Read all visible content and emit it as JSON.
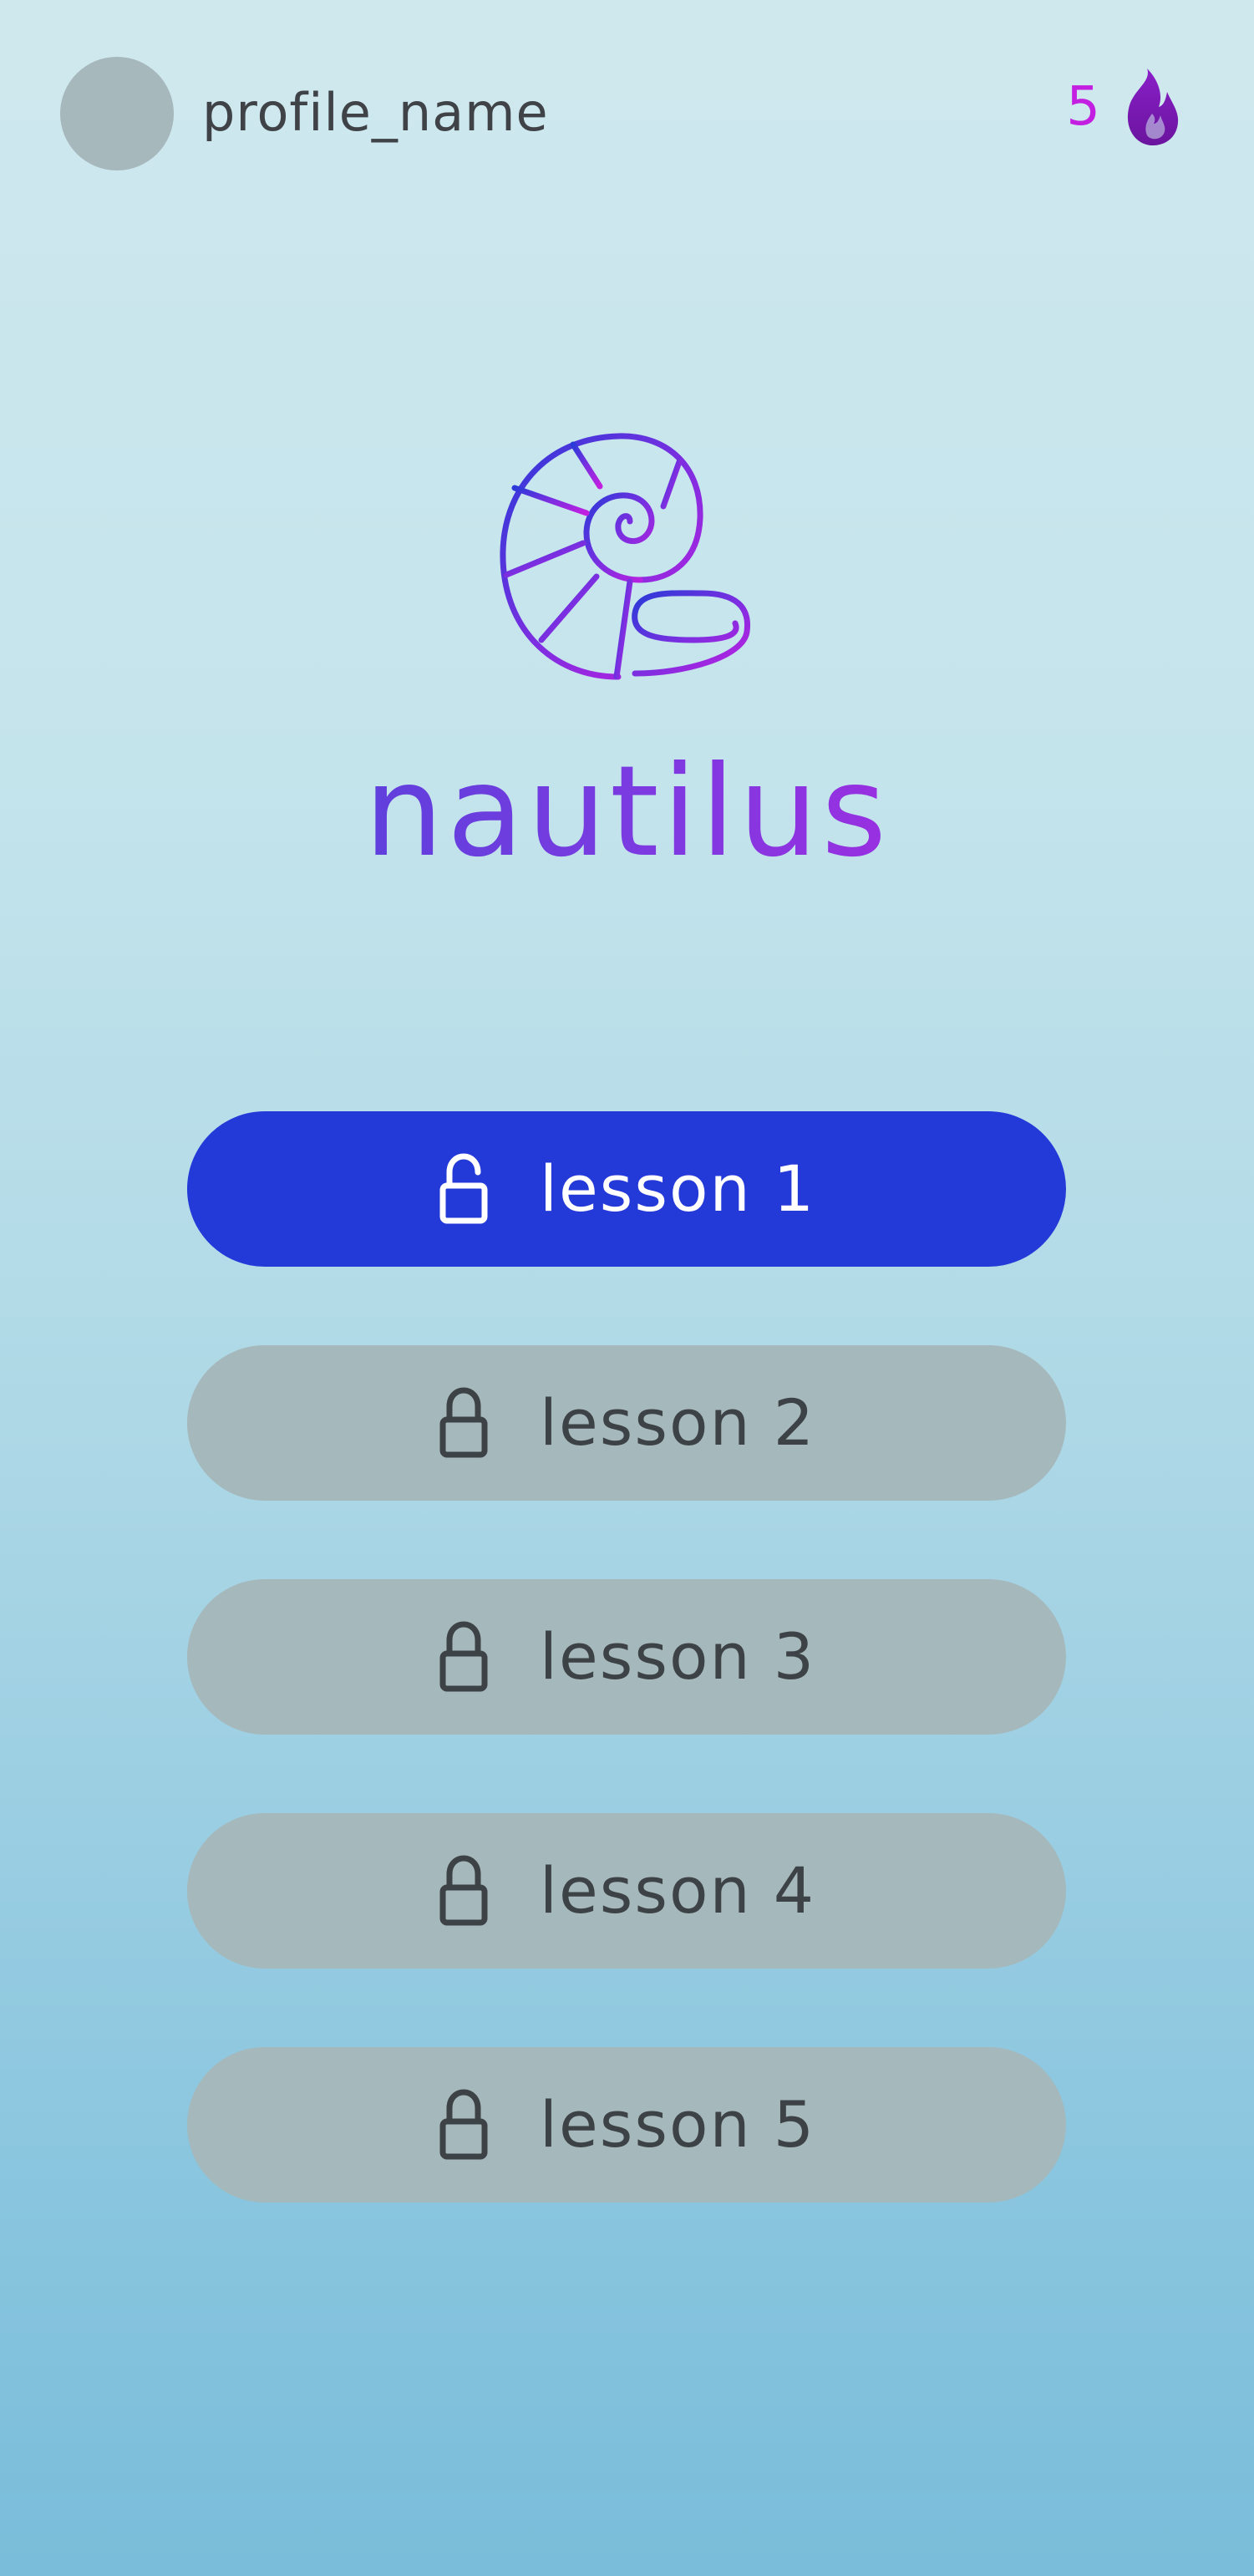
{
  "header": {
    "profile_name": "profile_name",
    "streak_count": "5",
    "streak_icon": "flame-icon"
  },
  "brand": {
    "name": "nautilus",
    "logo_icon": "nautilus-shell-icon"
  },
  "lessons": [
    {
      "label": "lesson 1",
      "state": "unlocked",
      "icon": "unlocked-padlock-icon"
    },
    {
      "label": "lesson 2",
      "state": "locked",
      "icon": "padlock-icon"
    },
    {
      "label": "lesson 3",
      "state": "locked",
      "icon": "padlock-icon"
    },
    {
      "label": "lesson 4",
      "state": "locked",
      "icon": "padlock-icon"
    },
    {
      "label": "lesson 5",
      "state": "locked",
      "icon": "padlock-icon"
    }
  ],
  "colors": {
    "accent_blue": "#2339d8",
    "accent_purple": "#c21fe0",
    "locked_button": "#a5b8bb",
    "avatar_placeholder": "#a6b8bb",
    "text_dark": "#3f4347"
  }
}
